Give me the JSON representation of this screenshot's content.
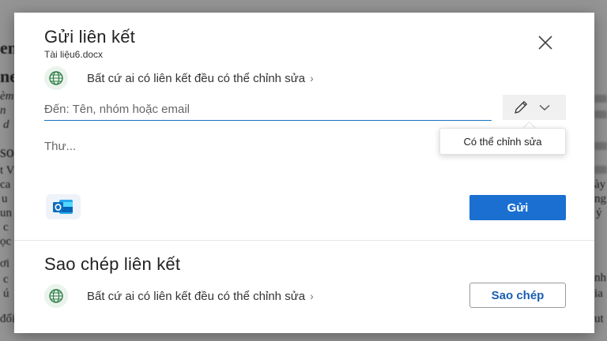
{
  "background_document": {
    "fragments": [
      "en",
      "ne",
      "èm",
      "n",
      "d",
      "so",
      "t V",
      "ca",
      "u",
      "un",
      "c",
      "ọc",
      "ơi",
      "c",
      "ú",
      "đổi",
      "ày",
      "ng",
      "ý",
      "nh",
      "ia",
      "ut"
    ]
  },
  "dialog": {
    "title": "Gửi liên kết",
    "filename": "Tài liệu6.docx",
    "close_icon": "close-icon",
    "permission": {
      "icon": "globe-icon",
      "label": "Bất cứ ai có liên kết đều có thể chỉnh sửa",
      "chevron": "›"
    },
    "recipient": {
      "placeholder": "Đến: Tên, nhóm hoặc email",
      "value": ""
    },
    "permission_dropdown": {
      "icon": "pencil-icon",
      "chevron_icon": "chevron-down-icon",
      "tooltip": "Có thể chỉnh sửa"
    },
    "message": {
      "placeholder": "Thư...",
      "value": ""
    },
    "outlook_icon": "outlook-icon",
    "send_label": "Gửi"
  },
  "copy_section": {
    "title": "Sao chép liên kết",
    "permission": {
      "icon": "globe-icon",
      "label": "Bất cứ ai có liên kết đều có thể chỉnh sửa",
      "chevron": "›"
    },
    "copy_label": "Sao chép"
  },
  "colors": {
    "accent": "#1a6fd1",
    "underline": "#1a6fbf",
    "globe": "#2e7d46"
  }
}
